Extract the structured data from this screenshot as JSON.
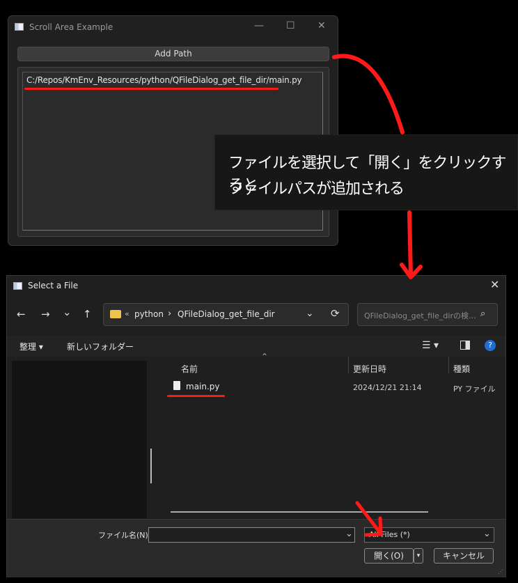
{
  "window": {
    "title": "Scroll Area Example",
    "minimize": "—",
    "maximize": "☐",
    "close": "✕",
    "add_path_label": "Add Path",
    "path_text": "C:/Repos/KmEnv_Resources/python/QFileDialog_get_file_dir/main.py"
  },
  "annotation": {
    "line1": "ファイルを選択して「開く」をクリックすると",
    "line2": "ファイルパスが追加される"
  },
  "dialog": {
    "title": "Select a File",
    "close": "✕",
    "nav": {
      "back": "←",
      "forward": "→",
      "recent": "⌄",
      "up": "↑"
    },
    "breadcrumb": {
      "prefix": "«",
      "part1": "python",
      "sep": "›",
      "part2": "QFileDialog_get_file_dir"
    },
    "search_placeholder": "QFileDialog_get_file_dirの検...",
    "toolbar": {
      "organize": "整理 ▾",
      "new_folder": "新しいフォルダー"
    },
    "columns": {
      "name": "名前",
      "date": "更新日時",
      "type": "種類"
    },
    "files": [
      {
        "name": "main.py",
        "date": "2024/12/21 21:14",
        "type": "PY ファイル"
      }
    ],
    "filename_label": "ファイル名(N):",
    "filename_value": "",
    "filetype_value": "All Files (*)",
    "open_label": "開く(O)",
    "cancel_label": "キャンセル"
  },
  "colors": {
    "accent_red": "#ff1a1a",
    "folder": "#f1c24c",
    "help": "#1f6fd1"
  }
}
